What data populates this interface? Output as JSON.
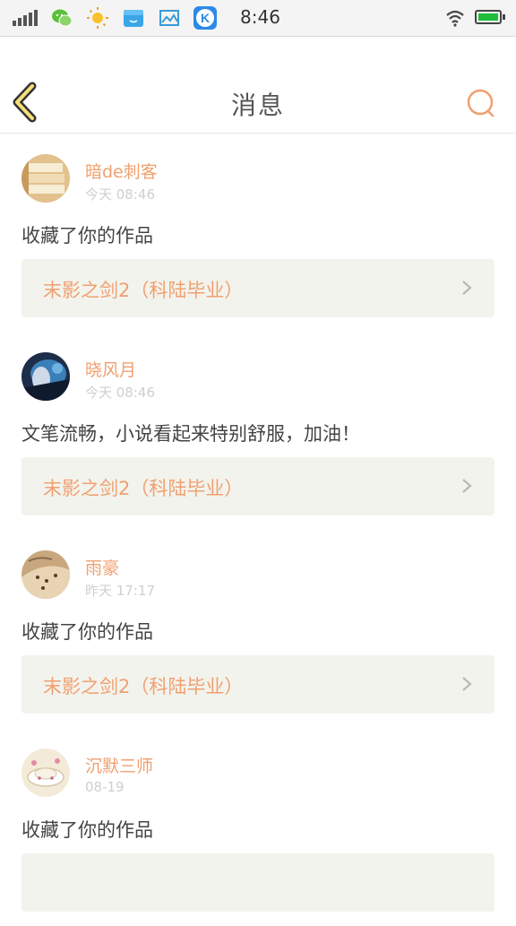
{
  "status_bar": {
    "time": "8:46",
    "app_icons": [
      "wechat-icon",
      "weather-icon",
      "file-icon",
      "gallery-icon",
      "k-app-icon"
    ],
    "k_app_letter": "K",
    "battery_level": 1.0
  },
  "header": {
    "title": "消息"
  },
  "messages": [
    {
      "username": "暗de刺客",
      "time": "今天 08:46",
      "content": "收藏了你的作品",
      "work_title": "末影之剑2（科陆毕业）"
    },
    {
      "username": "晓风月",
      "time": "今天 08:46",
      "content": "文笔流畅，小说看起来特别舒服，加油！",
      "work_title": "末影之剑2（科陆毕业）"
    },
    {
      "username": "雨豪",
      "time": "昨天 17:17",
      "content": "收藏了你的作品",
      "work_title": "末影之剑2（科陆毕业）"
    },
    {
      "username": "沉默三师",
      "time": "08-19",
      "content": "收藏了你的作品",
      "work_title": ""
    }
  ],
  "colors": {
    "accent": "#f0a070",
    "card_bg": "#f3f3ed",
    "separator": "#f2f2f2"
  }
}
